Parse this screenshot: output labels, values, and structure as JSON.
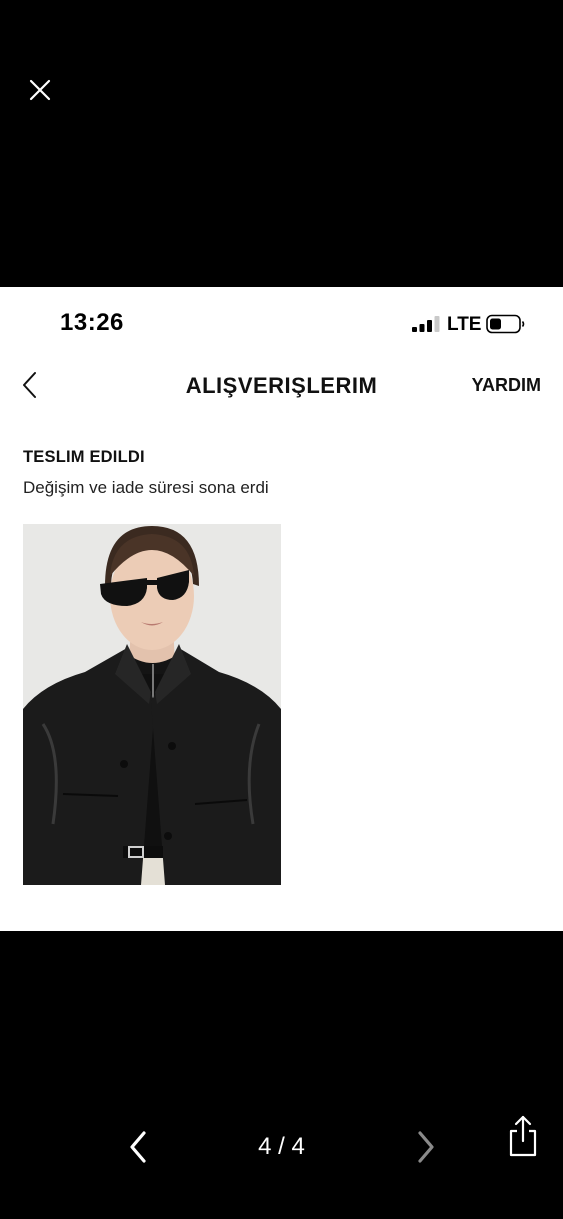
{
  "viewer": {
    "close_icon": "close-icon",
    "page_counter": "4 / 4",
    "prev_icon": "chevron-left-icon",
    "next_icon": "chevron-right-icon",
    "share_icon": "share-icon"
  },
  "status_bar": {
    "time": "13:26",
    "network": "LTE",
    "signal_icon": "cellular-signal-icon",
    "battery_icon": "battery-icon"
  },
  "nav": {
    "back_icon": "chevron-left-icon",
    "title": "ALIŞVERIŞLERIM",
    "help_label": "YARDIM"
  },
  "order": {
    "status": "TESLIM EDILDI",
    "note": "Değişim ve iade süresi sona erdi"
  },
  "product": {
    "image": "black leather jacket product photo"
  },
  "colors": {
    "viewer_bg": "#000000",
    "card_bg": "#ffffff",
    "text": "#111111",
    "disabled_arrow": "#8a8a8a"
  }
}
